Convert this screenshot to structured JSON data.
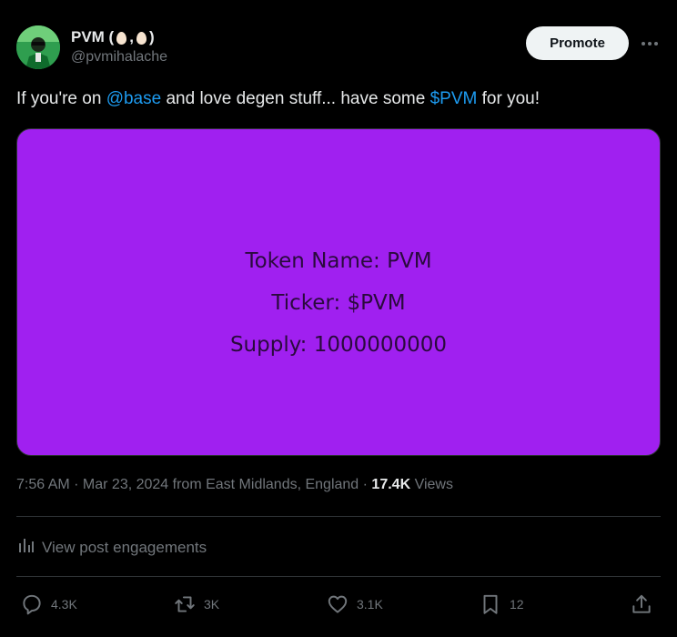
{
  "author": {
    "display_name_prefix": "PVM (",
    "display_name_sep": ",",
    "display_name_suffix": ")",
    "handle": "@pvmihalache"
  },
  "header": {
    "promote_label": "Promote",
    "more_icon": "more-horizontal-icon"
  },
  "tweet": {
    "text_part1": "If you're on ",
    "mention": "@base",
    "text_part2": " and love degen stuff... have some ",
    "cashtag": "$PVM",
    "text_part3": " for you!"
  },
  "media": {
    "background_color": "#a020f0",
    "line1": "Token Name: PVM",
    "line2": "Ticker: $PVM",
    "line3": "Supply: 1000000000"
  },
  "meta": {
    "time": "7:56 AM",
    "sep1": " · ",
    "date": "Mar 23, 2024",
    "location": " from East Midlands, England",
    "sep2": " · ",
    "views_count": "17.4K",
    "views_label": " Views"
  },
  "engagements": {
    "label": "View post engagements",
    "icon": "analytics-icon"
  },
  "actions": {
    "replies": "4.3K",
    "reposts": "3K",
    "likes": "3.1K",
    "bookmarks": "12"
  },
  "colors": {
    "background": "#000000",
    "link": "#1d9bf0",
    "muted": "#71767b",
    "text": "#e7e9ea"
  }
}
